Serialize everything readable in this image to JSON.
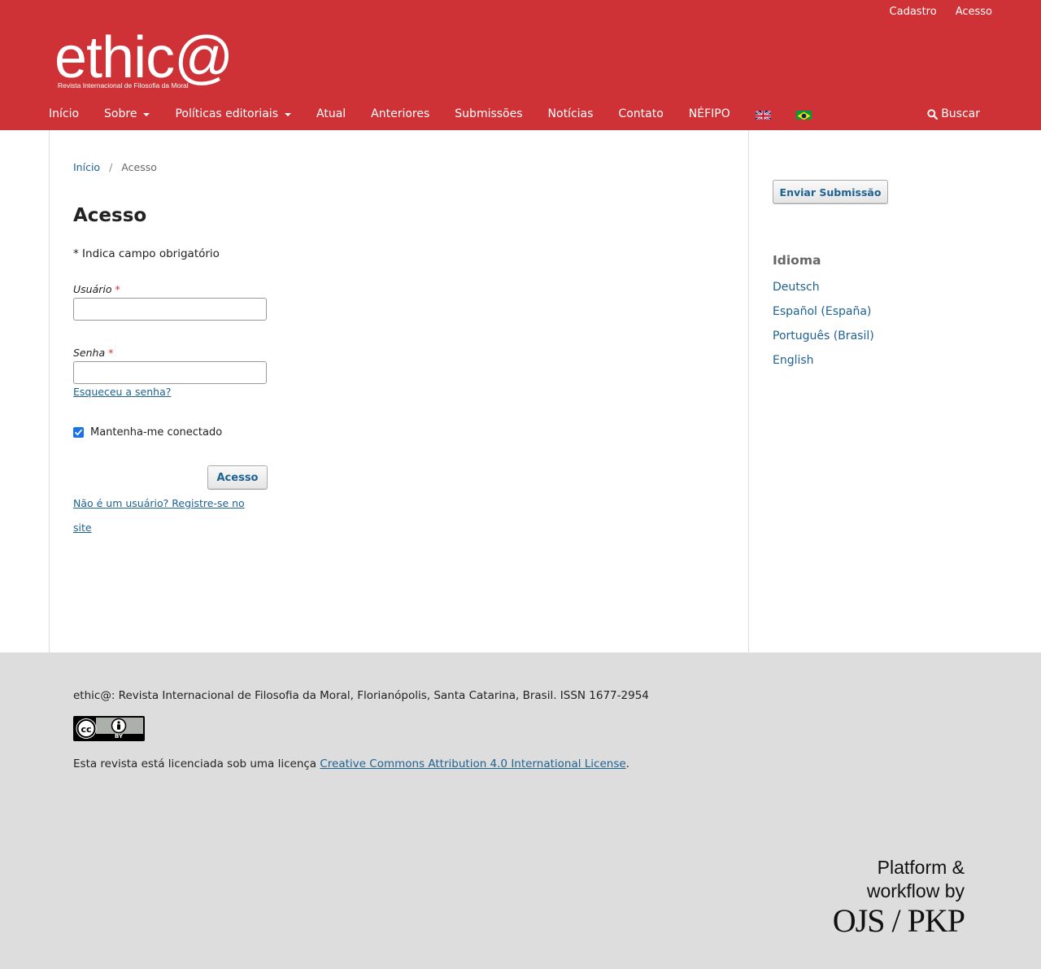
{
  "header": {
    "user_nav": {
      "register": "Cadastro",
      "login": "Acesso"
    },
    "logo": {
      "word": "ethic@",
      "subtitle": "Revista Internacional de Filosofia da Moral"
    },
    "nav": {
      "home": "Início",
      "about": "Sobre",
      "policies": "Políticas editoriais",
      "current": "Atual",
      "archives": "Anteriores",
      "submissions": "Submissões",
      "news": "Notícias",
      "contact": "Contato",
      "nefipo": "NÉFIPO"
    },
    "search": "Buscar",
    "color": "#cf3236"
  },
  "breadcrumb": {
    "home": "Início",
    "separator": "/",
    "current": "Acesso"
  },
  "page_title": "Acesso",
  "required_note": "* Indica campo obrigatório",
  "form": {
    "username_label": "Usuário",
    "password_label": "Senha",
    "required_mark": "*",
    "username_value": "",
    "password_value": "",
    "forgot_password": "Esqueceu a senha?",
    "remember_me": "Mantenha-me conectado",
    "remember_checked": true,
    "submit": "Acesso",
    "register_link": "Não é um usuário? Registre-se no site"
  },
  "sidebar": {
    "submit_button": "Enviar Submissão",
    "language_title": "Idioma",
    "languages": [
      "Deutsch",
      "Español (España)",
      "Português (Brasil)",
      "English"
    ]
  },
  "footer": {
    "info": "ethic@: Revista Internacional de Filosofia da Moral, Florianópolis, Santa Catarina, Brasil. ISSN 1677-2954",
    "cc_label": "BY",
    "license_prefix": "Esta revista está licenciada sob uma licença ",
    "license_link": "Creative Commons Attribution 4.0 International License",
    "license_suffix": ".",
    "pkp_line1": "Platform &",
    "pkp_line2": "workflow by",
    "pkp_line3": "OJS / PKP"
  },
  "icons": {
    "search": "search-icon",
    "flag_en": "uk-flag-icon",
    "flag_br": "brazil-flag-icon",
    "cc": "creative-commons-icon"
  }
}
